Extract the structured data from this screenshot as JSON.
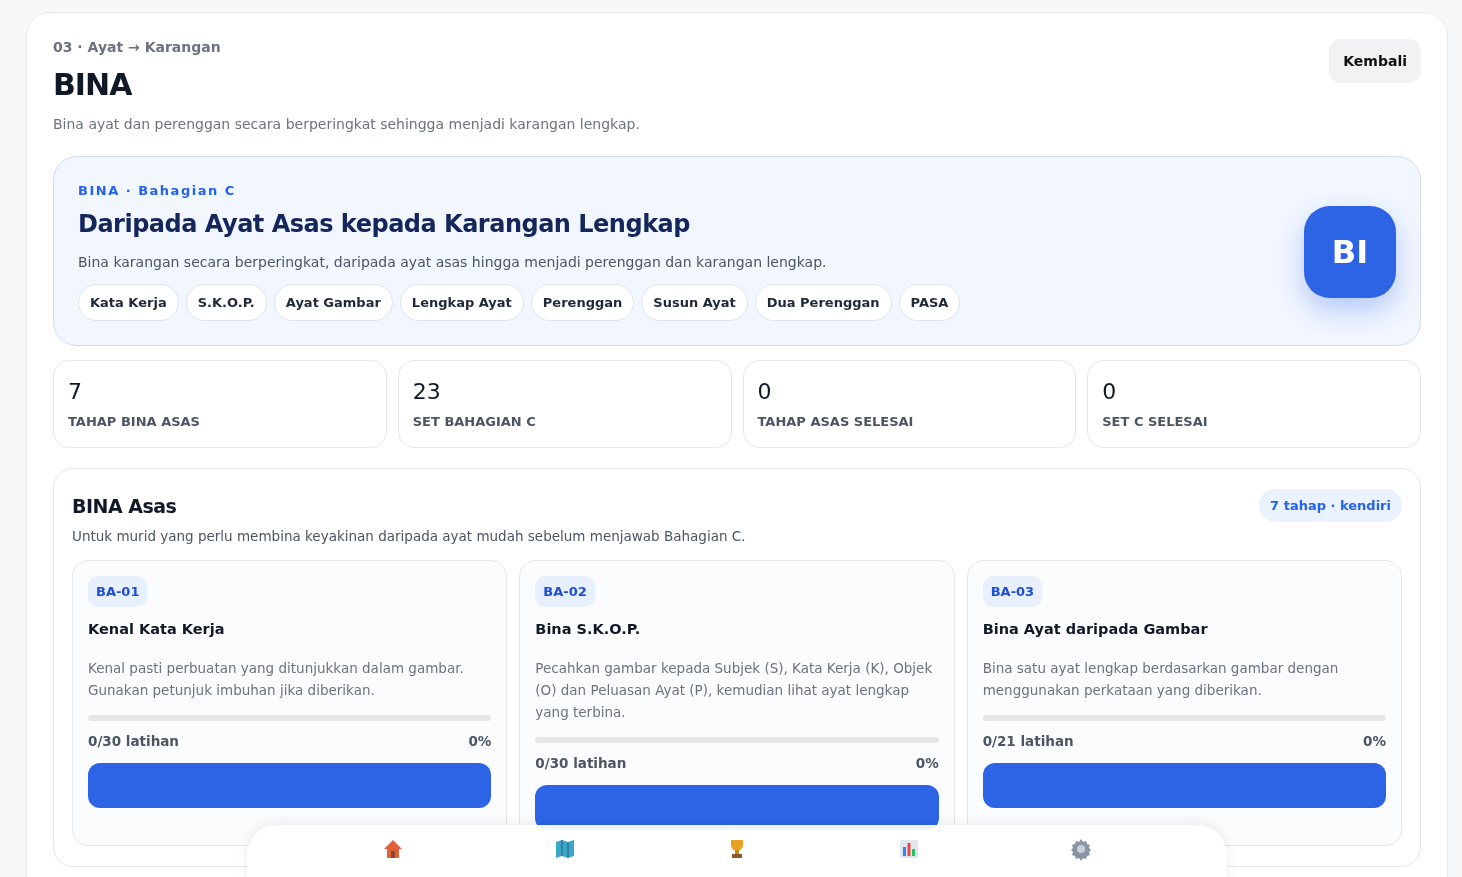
{
  "header": {
    "breadcrumb": "03 · Ayat → Karangan",
    "title": "BINA",
    "subtitle": "Bina ayat dan perenggan secara berperingkat sehingga menjadi karangan lengkap.",
    "back_button": "Kembali"
  },
  "hero": {
    "eyebrow": "BINA · Bahagian C",
    "title": "Daripada Ayat Asas kepada Karangan Lengkap",
    "description": "Bina karangan secara berperingkat, daripada ayat asas hingga menjadi perenggan dan karangan lengkap.",
    "logo": "BI",
    "chips": [
      "Kata Kerja",
      "S.K.O.P.",
      "Ayat Gambar",
      "Lengkap Ayat",
      "Perenggan",
      "Susun Ayat",
      "Dua Perenggan",
      "PASA"
    ]
  },
  "stats": [
    {
      "value": "7",
      "label": "TAHAP BINA ASAS"
    },
    {
      "value": "23",
      "label": "SET BAHAGIAN C"
    },
    {
      "value": "0",
      "label": "TAHAP ASAS SELESAI"
    },
    {
      "value": "0",
      "label": "SET C SELESAI"
    }
  ],
  "section": {
    "title": "BINA Asas",
    "badge": "7 tahap · kendiri",
    "description": "Untuk murid yang perlu membina keyakinan daripada ayat mudah sebelum menjawab Bahagian C.",
    "cards": [
      {
        "code": "BA-01",
        "title": "Kenal Kata Kerja",
        "description": "Kenal pasti perbuatan yang ditunjukkan dalam gambar. Gunakan petunjuk imbuhan jika diberikan.",
        "progress": "0/30 latihan",
        "percent": "0%",
        "level": 0
      },
      {
        "code": "BA-02",
        "title": "Bina S.K.O.P.",
        "description": "Pecahkan gambar kepada Subjek (S), Kata Kerja (K), Objek (O) dan Peluasan Ayat (P), kemudian lihat ayat lengkap yang terbina.",
        "progress": "0/30 latihan",
        "percent": "0%",
        "level": 0
      },
      {
        "code": "BA-03",
        "title": "Bina Ayat daripada Gambar",
        "description": "Bina satu ayat lengkap berdasarkan gambar dengan menggunakan perkataan yang diberikan.",
        "progress": "0/21 latihan",
        "percent": "0%",
        "level": 0
      }
    ]
  },
  "bottom_nav": [
    {
      "kind": "house"
    },
    {
      "kind": "map"
    },
    {
      "kind": "trophy"
    },
    {
      "kind": "chart"
    },
    {
      "kind": "gear"
    }
  ]
}
